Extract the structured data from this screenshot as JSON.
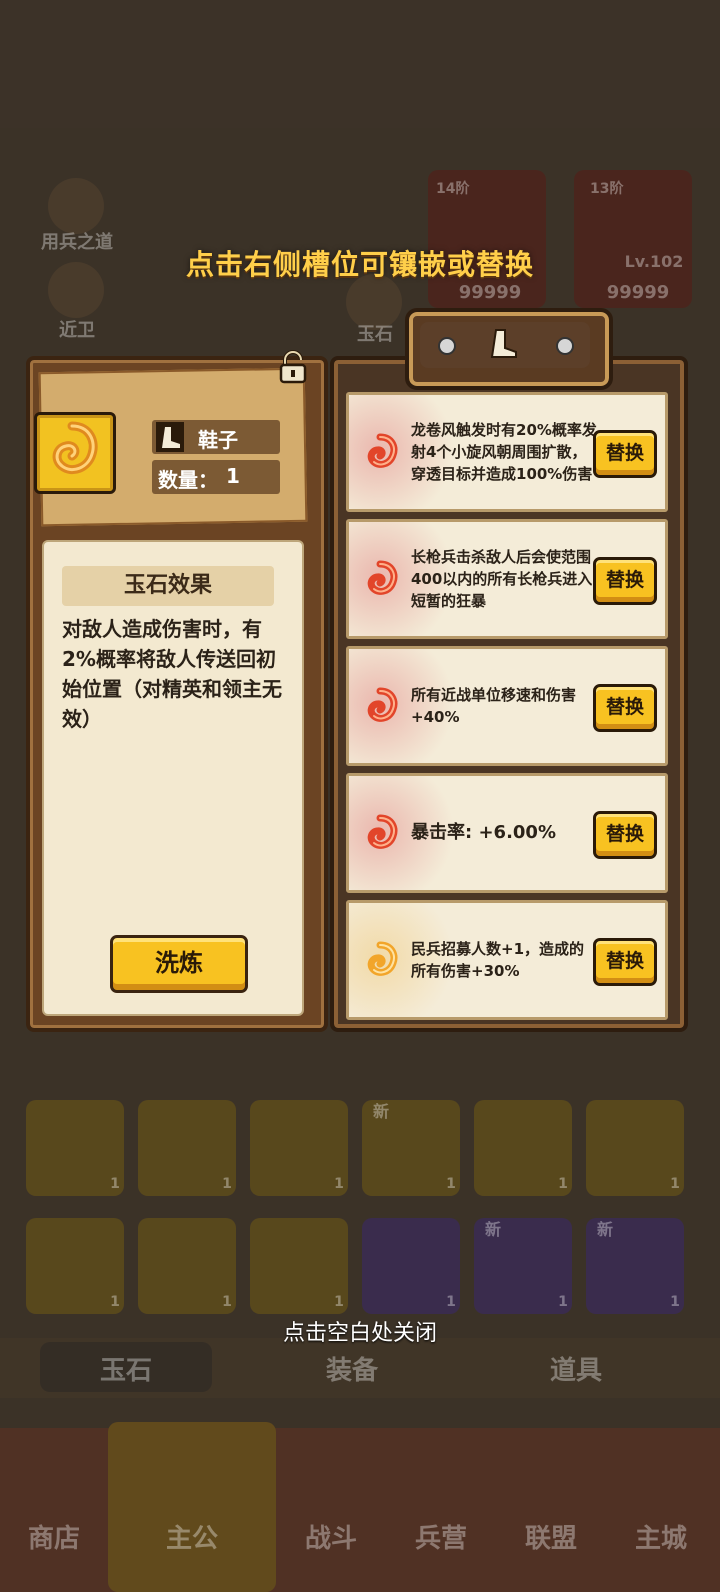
{
  "hint_top": "点击右侧槽位可镶嵌或替换",
  "hint_bottom": "点击空白处关闭",
  "background": {
    "side_labels": [
      "用兵之道",
      "近卫",
      "玉石"
    ],
    "card_levels": [
      "14阶",
      "13阶"
    ],
    "card_info": "Lv.102",
    "card_values": [
      "99999",
      "99999"
    ],
    "tabs": [
      "玉石",
      "装备",
      "道具"
    ],
    "tile_counts": [
      "1",
      "1",
      "1",
      "1",
      "1",
      "1",
      "1",
      "1",
      "1",
      "1",
      "1",
      "1"
    ],
    "new_badges": [
      "新",
      "新",
      "新"
    ],
    "nav": [
      "商店",
      "主公",
      "战斗",
      "兵营",
      "联盟",
      "主城"
    ]
  },
  "item": {
    "icon": "gold-swirl-jade-icon",
    "type_icon": "boot-icon",
    "type_name": "鞋子",
    "quantity_label": "数量：",
    "quantity": "1",
    "effect_title": "玉石效果",
    "effect_desc": "对敌人造成伤害时，有2%概率将敌人传送回初始位置（对精英和领主无效）",
    "refine_label": "洗炼",
    "lock_icon": "unlocked-padlock-icon"
  },
  "slots_header_icon": "boot-icon",
  "slots": [
    {
      "text": "龙卷风触发时有20%概率发射4个小旋风朝周围扩散，穿透目标并造成100%伤害",
      "icon": "red-swirl-jade-icon",
      "button": "替换"
    },
    {
      "text": "长枪兵击杀敌人后会使范围400以内的所有长枪兵进入短暂的狂暴",
      "icon": "red-swirl-jade-icon",
      "button": "替换"
    },
    {
      "text": "所有近战单位移速和伤害+40%",
      "icon": "red-swirl-jade-icon",
      "button": "替换"
    },
    {
      "text": "暴击率: +6.00%",
      "icon": "red-swirl-jade-icon",
      "button": "替换"
    },
    {
      "text": "民兵招募人数+1，造成的所有伤害+30%",
      "icon": "gold-swirl-jade-icon",
      "button": "替换"
    }
  ],
  "colors": {
    "gold": "#f8c221",
    "red_jade": "#e2452a",
    "gold_jade": "#f2a52a",
    "hint": "#ffcf4a"
  }
}
